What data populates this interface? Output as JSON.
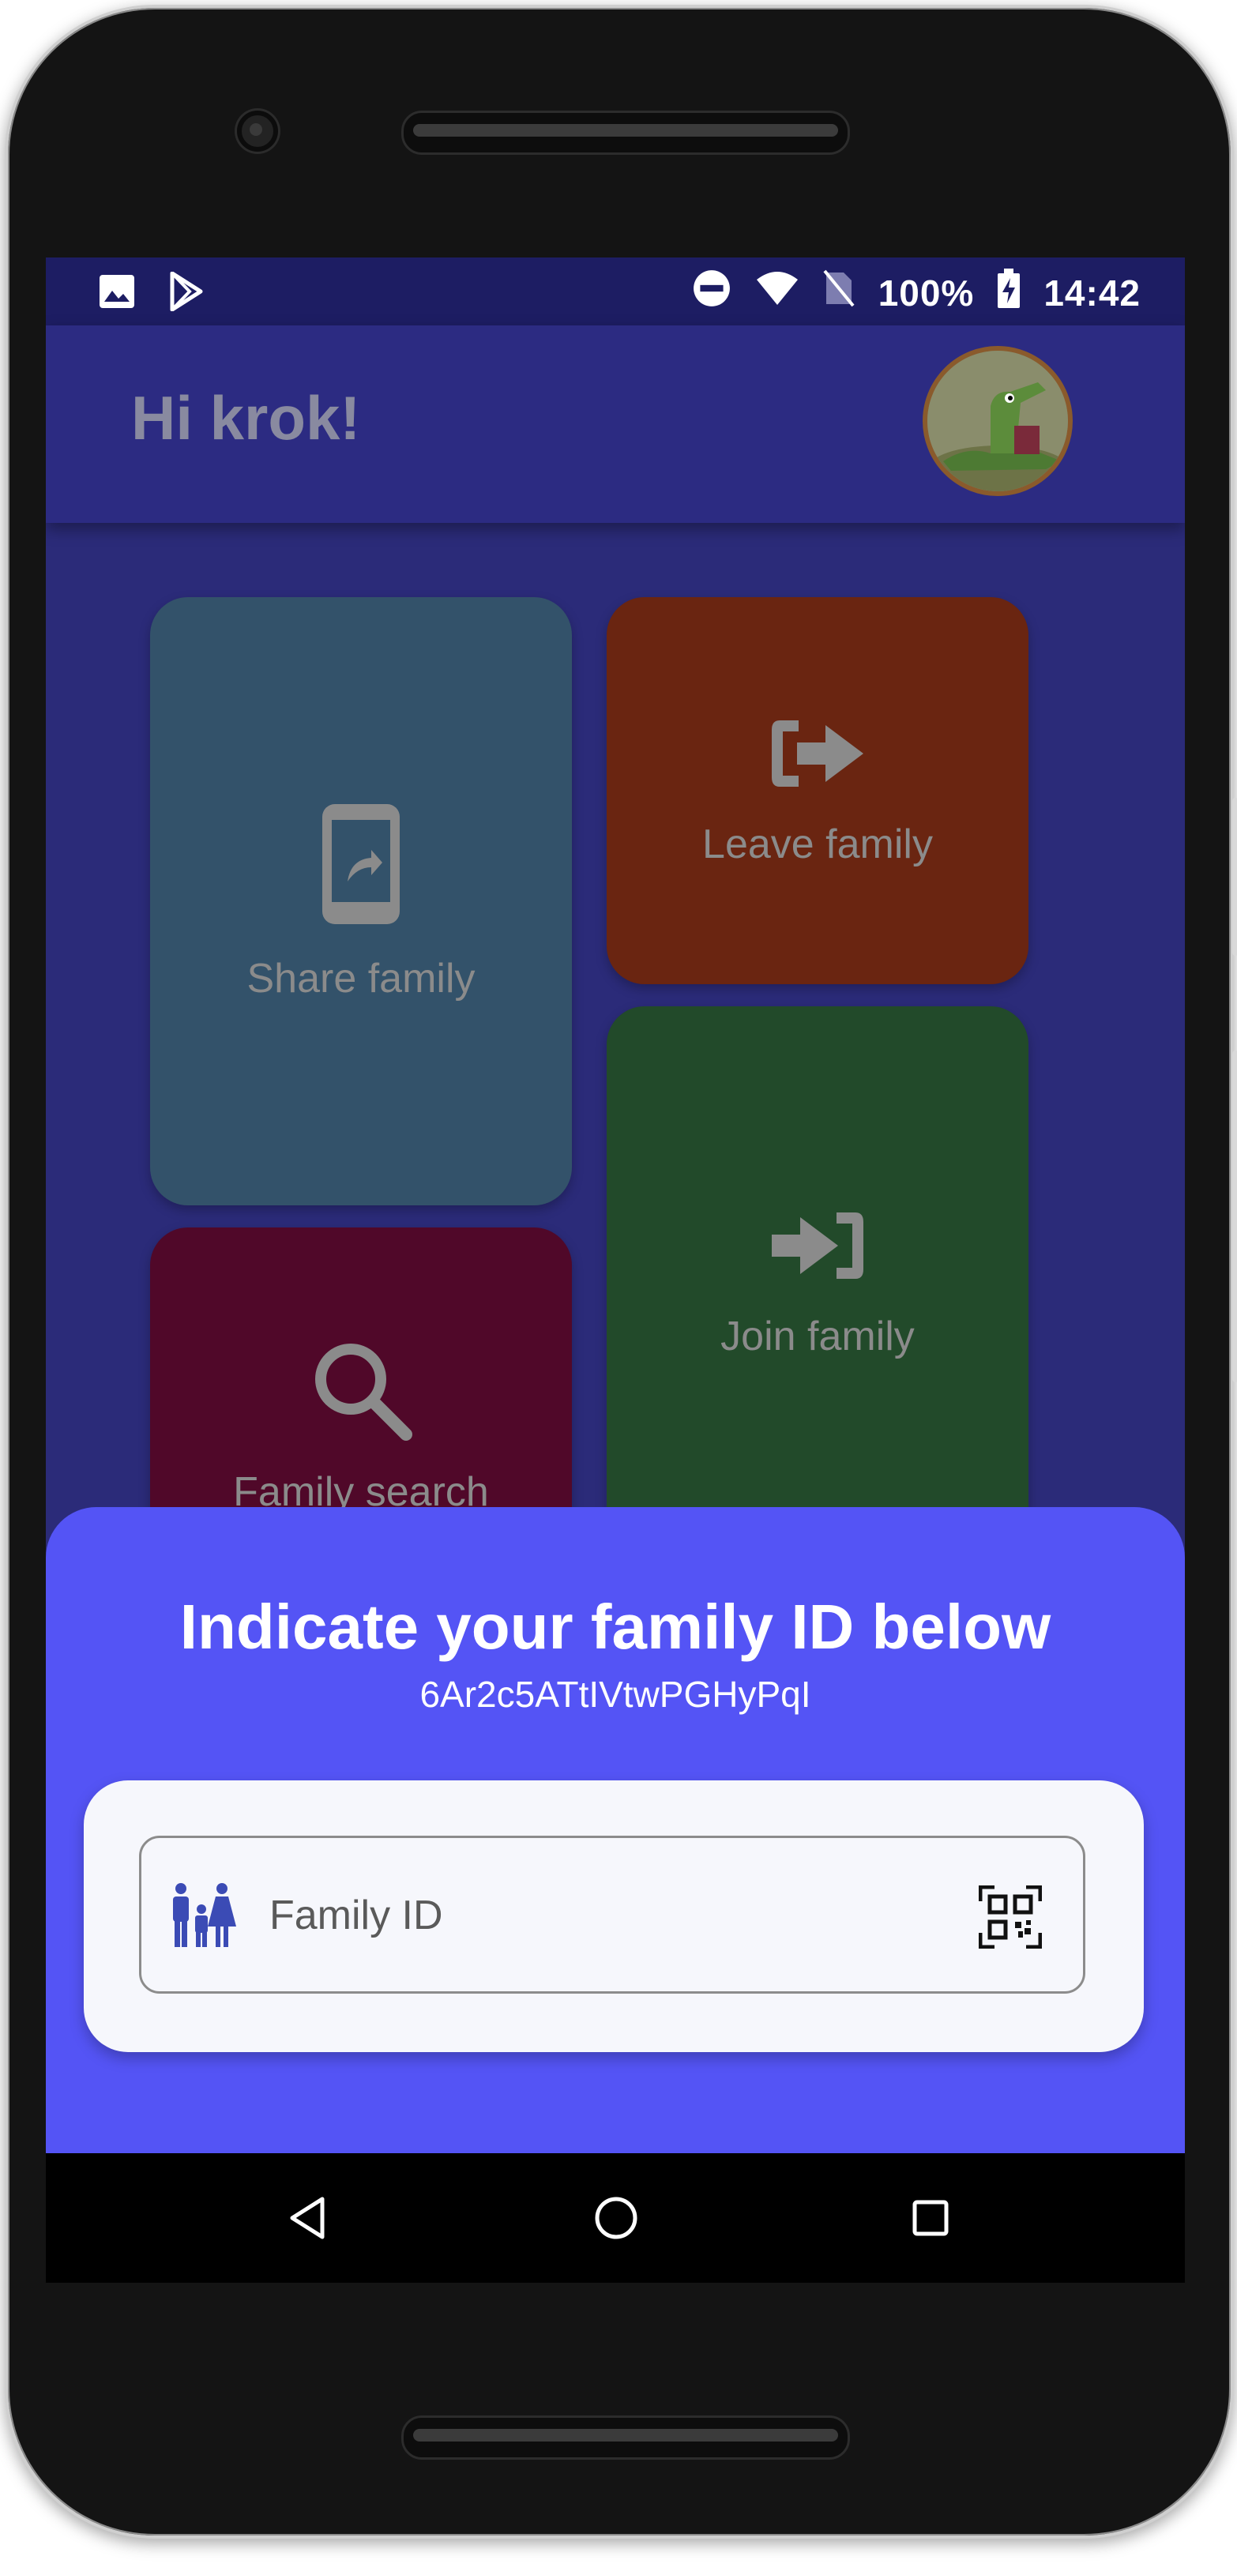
{
  "status_bar": {
    "battery": "100%",
    "time": "14:42",
    "icons": [
      "image-icon",
      "play-store-icon",
      "do-not-disturb-icon",
      "wifi-icon",
      "no-sim-icon",
      "battery-charging-icon"
    ]
  },
  "app_bar": {
    "greeting": "Hi krok!",
    "avatar": "crocodile-avatar"
  },
  "tiles": {
    "share": {
      "label": "Share family",
      "icon": "share-phone-icon",
      "color": "#33526a"
    },
    "leave": {
      "label": "Leave family",
      "icon": "sign-out-icon",
      "color": "#6a2511"
    },
    "join": {
      "label": "Join family",
      "icon": "sign-in-icon",
      "color": "#224a2a"
    },
    "search": {
      "label": "Family search",
      "icon": "search-icon",
      "color": "#500829"
    }
  },
  "sheet": {
    "title": "Indicate your family ID below",
    "family_id": "6Ar2c5ATtIVtwPGHyPqI",
    "field": {
      "placeholder": "Family ID",
      "value": "",
      "leading_icon": "family-icon",
      "trailing_icon": "qr-code-icon"
    },
    "color": "#5454f5"
  },
  "nav_bar": {
    "buttons": [
      "back-icon",
      "home-icon",
      "recents-icon"
    ]
  }
}
